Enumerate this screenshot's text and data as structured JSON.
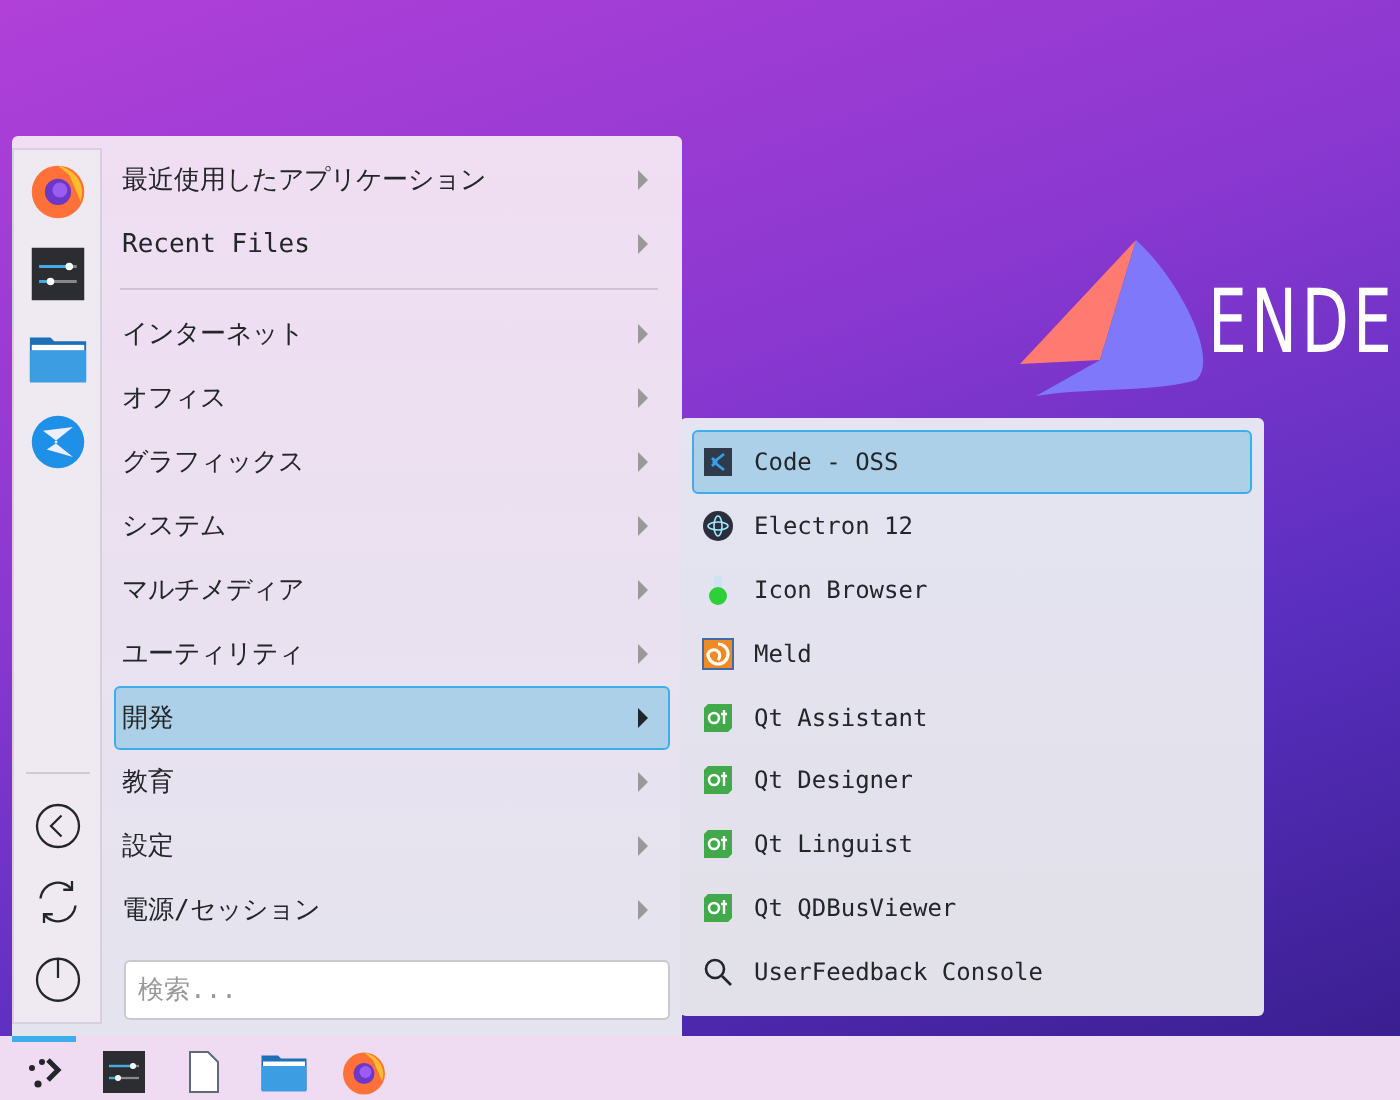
{
  "wallpaper": {
    "logo_text": "ENDE"
  },
  "menu": {
    "favorites": [
      {
        "kind": "browser"
      },
      {
        "kind": "sliders"
      },
      {
        "kind": "folder"
      },
      {
        "kind": "bird"
      }
    ],
    "session": [
      {
        "kind": "back"
      },
      {
        "kind": "restart"
      },
      {
        "kind": "power"
      }
    ],
    "sections": [
      [
        {
          "label": "最近使用したアプリケーション",
          "selected": false
        },
        {
          "label": "Recent Files",
          "selected": false
        }
      ],
      [
        {
          "label": "インターネット",
          "selected": false
        },
        {
          "label": "オフィス",
          "selected": false
        },
        {
          "label": "グラフィックス",
          "selected": false
        },
        {
          "label": "システム",
          "selected": false
        },
        {
          "label": "マルチメディア",
          "selected": false
        },
        {
          "label": "ユーティリティ",
          "selected": false
        },
        {
          "label": "開発",
          "selected": true
        },
        {
          "label": "教育",
          "selected": false
        },
        {
          "label": "設定",
          "selected": false
        },
        {
          "label": "電源/セッション",
          "selected": false
        }
      ]
    ],
    "search": {
      "placeholder": "検索..."
    }
  },
  "submenu": [
    {
      "label": "Code - OSS",
      "kind": "code",
      "selected": true
    },
    {
      "label": "Electron 12",
      "kind": "atom",
      "selected": false
    },
    {
      "label": "Icon Browser",
      "kind": "flask",
      "selected": false
    },
    {
      "label": "Meld",
      "kind": "meld",
      "selected": false
    },
    {
      "label": "Qt Assistant",
      "kind": "qt",
      "selected": false
    },
    {
      "label": "Qt Designer",
      "kind": "qt",
      "selected": false
    },
    {
      "label": "Qt Linguist",
      "kind": "qt",
      "selected": false
    },
    {
      "label": "Qt QDBusViewer",
      "kind": "qt",
      "selected": false
    },
    {
      "label": "UserFeedback Console",
      "kind": "search",
      "selected": false
    }
  ],
  "taskbar": [
    {
      "kind": "launcher",
      "active": true
    },
    {
      "kind": "sliders",
      "active": false
    },
    {
      "kind": "file",
      "active": false
    },
    {
      "kind": "folder",
      "active": false
    },
    {
      "kind": "browser",
      "active": false
    }
  ]
}
